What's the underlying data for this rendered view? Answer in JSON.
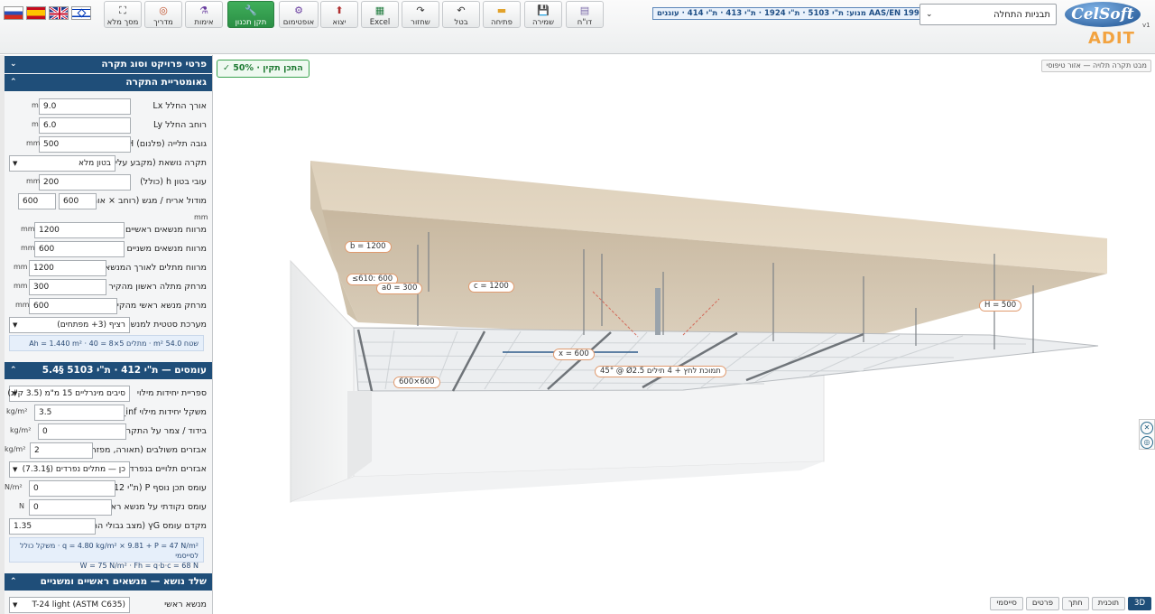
{
  "toolbar": {
    "buttons": [
      {
        "label": "מסך מלא",
        "icon": "fullscreen-icon"
      },
      {
        "label": "מדריך",
        "icon": "guide-icon"
      },
      {
        "label": "אימות",
        "icon": "verify-icon"
      },
      {
        "label": "תקן תכנון",
        "icon": "wrench-icon"
      },
      {
        "label": "אופטימום",
        "icon": "gear-icon"
      },
      {
        "label": "יצוא",
        "icon": "export-icon"
      },
      {
        "label": "Excel",
        "icon": "excel-icon"
      },
      {
        "label": "שחזור",
        "icon": "redo-icon"
      },
      {
        "label": "בטל",
        "icon": "undo-icon"
      },
      {
        "label": "פתיחה",
        "icon": "folder-icon"
      },
      {
        "label": "שמירה",
        "icon": "save-icon"
      },
      {
        "label": "דו\"ח",
        "icon": "report-icon"
      }
    ],
    "standard_banner": "מנוע: ת\"י 5103 · ת\"י 1924 · ת\"י 413 · ת\"י 414 · עוגנים AAS/EN 1992-4",
    "template_select": "תבניות התחלה",
    "logo_text": "CelSoft",
    "logo_sub": "ADIT",
    "version": "v1"
  },
  "panel": {
    "sections": {
      "project": "פרטי פרויקט וסוג תקרה",
      "geometry": "גאומטריית התקרה",
      "loads": "עומסים — ת\"י 412 · ת\"י 5103 §5.4",
      "carrier": "שלד נושא — מנשאים ראשיים ומשניים"
    },
    "geometry": {
      "lx_label": "אורך החלל Lx",
      "lx_value": "9.0",
      "lx_unit": "m",
      "ly_label": "רוחב החלל Ly",
      "ly_value": "6.0",
      "ly_unit": "m",
      "h_label": "גובה תלייה (פלנום) H",
      "h_value": "500",
      "h_unit": "mm",
      "deck_label": "תקרה נושאת (מקבע עליון)",
      "deck_value": "בטון מלא",
      "thick_label": "עובי בטון h (כולל)",
      "thick_value": "200",
      "thick_unit": "mm",
      "module_label": "מודול אריח / מגש (רוחב × אורך)",
      "module_w": "600",
      "module_l": "600",
      "module_unit": "mm",
      "b_label": "מרווח מנשאים ראשיים b",
      "b_value": "1200",
      "b_unit": "mm",
      "x_label": "מרווח מנשאים משניים x",
      "x_value": "600",
      "x_unit": "mm",
      "c_label": "מרווח מתלים לאורך המנשא c",
      "c_value": "1200",
      "c_unit": "mm",
      "a0_label": "מרחק מתלה ראשון מהקיר a0",
      "a0_value": "300",
      "a0_unit": "mm",
      "edge_label": "מרחק מנשא ראשי מהקיר",
      "edge_value": "600",
      "edge_unit": "mm",
      "seismic_label": "מערכת סטטית למנשא",
      "seismic_value": "רציף (3+ מפתחים)",
      "summary": "שטח 54.0 m² · מתלים 5×8 = 40 · Ah = 1.440 m²"
    },
    "loads": {
      "unit_label": "ספריית יחידות מילוי",
      "unit_value": "סיבים מינרליים 15 מ\"מ (3.5 ק\"ג)",
      "ginf_label": "משקל יחידות מילוי g_inf",
      "ginf_value": "3.5",
      "ginf_unit": "kg/m²",
      "insul_label": "בידוד / צמר על התקרה",
      "insul_value": "0",
      "insul_unit": "kg/m²",
      "integ_label": "אבזרים משולבים (תאורה, מפזרים)",
      "integ_value": "2",
      "integ_unit": "kg/m²",
      "hang_label": "אבזרים תלויים בנפרד?",
      "hang_value": "כן — מתלים נפרדים (§7.3.1)",
      "p_label": "עומס תכן נוסף P (ת\"י 412)",
      "p_value": "0",
      "p_unit": "N/m²",
      "pt_label": "עומס נקודתי על מנשא ראשי",
      "pt_value": "0",
      "pt_unit": "N",
      "gamma_label": "מקדם עומס γG (מצב גבולי הרס)",
      "gamma_value": "1.35",
      "summary_1": "q = 4.80 kg/m² × 9.81 + P = 47 N/m² · משקל כולל לסייסמי",
      "summary_2": "W = 75 N/m² · Fh = q·b·c = 68 N"
    },
    "carrier": {
      "main_label": "מנשא ראשי",
      "main_value": "T-24 light (ASTM C635)"
    }
  },
  "viewport": {
    "status": "✓ התכן תקין · 50%",
    "caption": "מבט תקרה תלויה — אזור טיפוסי",
    "dims": {
      "b": "b = 1200",
      "le610": "≤610: 600",
      "a0": "a0 = 300",
      "c": "c = 1200",
      "h": "H = 500",
      "x": "x = 600",
      "brace": "45° @ Ø2.5 תמוכת לחץ + 4 תילים",
      "tile": "600×600"
    },
    "tabs": [
      "3D",
      "תוכנית",
      "חתך",
      "פרטים",
      "סייסמי"
    ]
  },
  "colors": {
    "header_blue": "#1f4e79",
    "active_green": "#2b8f45",
    "dim_border": "#e09a6e",
    "slab": "#e6d6bf"
  }
}
